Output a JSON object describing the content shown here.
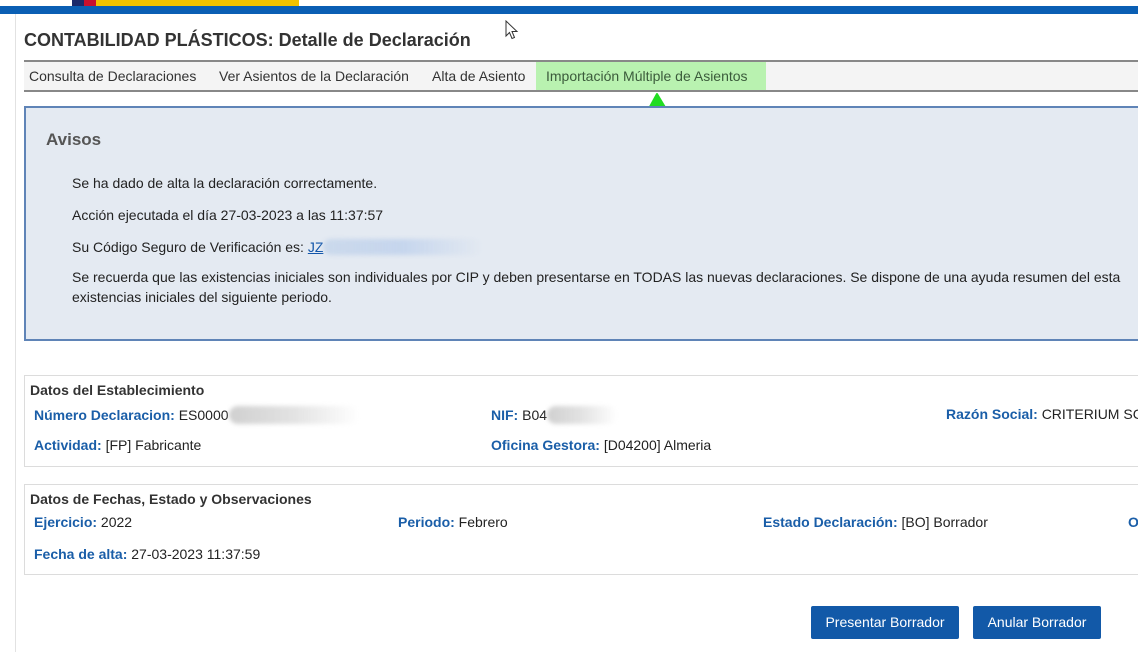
{
  "header": {
    "title": "CONTABILIDAD PLÁSTICOS: Detalle de Declaración",
    "colors": {
      "brand_blue": "#0a5fb4",
      "flag_red": "#c8102e",
      "flag_yellow": "#f2c200"
    }
  },
  "tabs": [
    {
      "label": "Consulta de Declaraciones"
    },
    {
      "label": "Ver Asientos de la Declaración"
    },
    {
      "label": "Alta de Asiento"
    },
    {
      "label": "Importación Múltiple de Asientos",
      "highlighted": true,
      "highlight_color": "#b9f2b0"
    }
  ],
  "annotation": {
    "arrow_color": "#22dd22"
  },
  "notice": {
    "title": "Avisos",
    "line1": "Se ha dado de alta la declaración correctamente.",
    "line2": "Acción ejecutada el día 27-03-2023 a las 11:37:57",
    "csv_label": "Su Código Seguro de Verificación es:",
    "csv_value": "JZ",
    "line4": "Se recuerda que las existencias iniciales son individuales por CIP y deben presentarse en TODAS las nuevas declaraciones. Se dispone de una ayuda resumen del esta",
    "line5": "existencias iniciales del siguiente periodo."
  },
  "establishment": {
    "title": "Datos del Establecimiento",
    "num_decl_label": "Número Declaracion:",
    "num_decl_value": "ES0000",
    "nif_label": "NIF:",
    "nif_value": "B04",
    "razon_label": "Razón Social:",
    "razon_value": "CRITERIUM SC",
    "actividad_label": "Actividad:",
    "actividad_value": "[FP] Fabricante",
    "oficina_label": "Oficina Gestora:",
    "oficina_value": "[D04200] Almeria"
  },
  "dates": {
    "title": "Datos de Fechas, Estado y Observaciones",
    "ejercicio_label": "Ejercicio:",
    "ejercicio_value": "2022",
    "periodo_label": "Periodo:",
    "periodo_value": "Febrero",
    "estado_label": "Estado Declaración:",
    "estado_value": "[BO] Borrador",
    "obs_label_cut": "O",
    "fecha_alta_label": "Fecha de alta:",
    "fecha_alta_value": "27-03-2023 11:37:59"
  },
  "actions": {
    "present_label": "Presentar Borrador",
    "cancel_label": "Anular Borrador"
  }
}
